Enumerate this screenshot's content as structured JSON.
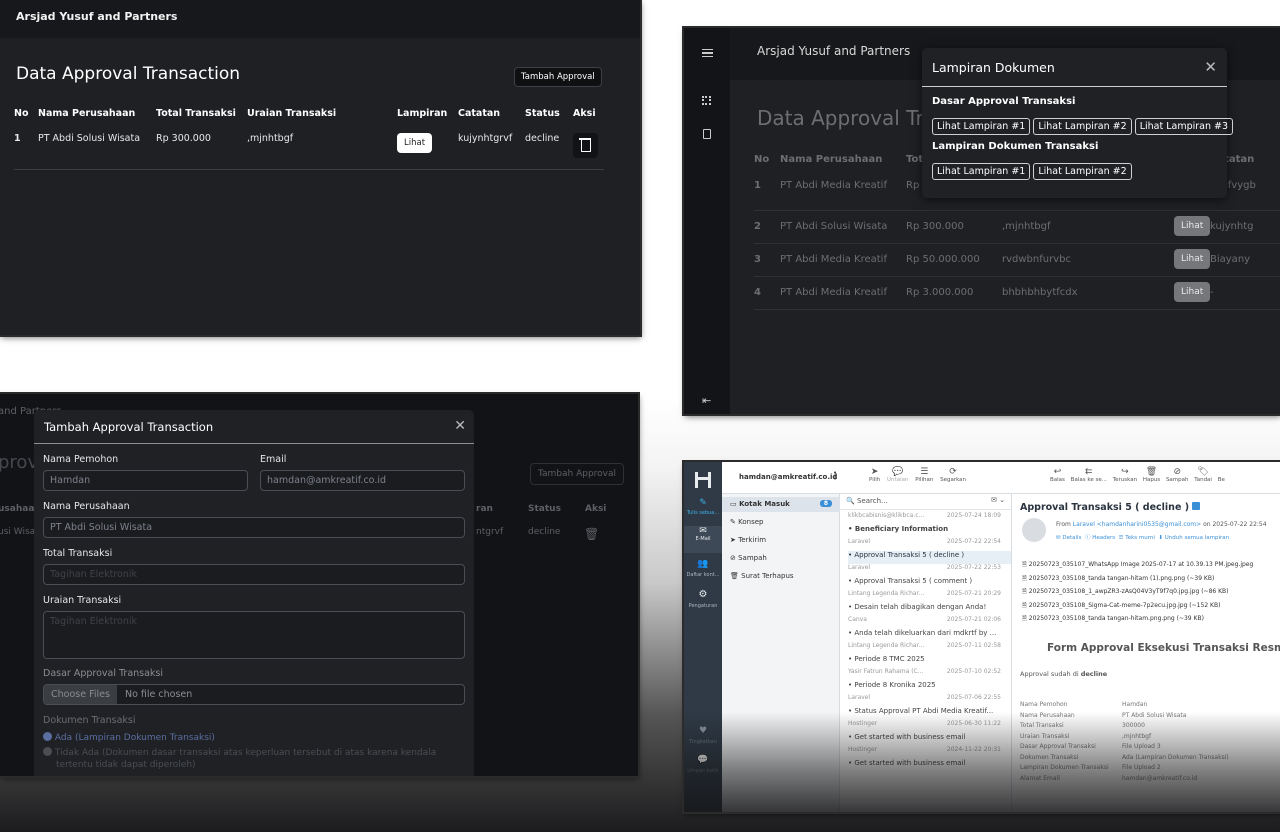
{
  "panel1": {
    "header": "Arsjad Yusuf and Partners",
    "title": "Data Approval Transaction",
    "add_button": "Tambah Approval",
    "columns": [
      "No",
      "Nama Perusahaan",
      "Total Transaksi",
      "Uraian Transaksi",
      "Lampiran",
      "Catatan",
      "Status",
      "Aksi"
    ],
    "rows": [
      {
        "no": "1",
        "company": "PT Abdi Solusi Wisata",
        "total": "Rp 300.000",
        "desc": ",mjnhtbgf",
        "attach": "Lihat",
        "note": "kujynhtgrvf",
        "status": "decline"
      }
    ]
  },
  "panel2": {
    "header": "Arsjad Yusuf and Partners",
    "title_partial": "Data Approval Tr",
    "columns": [
      "No",
      "Nama Perusahaan",
      "Tot",
      "Catatan"
    ],
    "rows": [
      {
        "no": "1",
        "company": "PT Abdi Media Kreatif",
        "total": "Rp",
        "desc": "",
        "attach": "",
        "note": "xdcfvygb"
      },
      {
        "no": "2",
        "company": "PT Abdi Solusi Wisata",
        "total": "Rp 300.000",
        "desc": ",mjnhtbgf",
        "attach": "Lihat",
        "note": "kujynhtg"
      },
      {
        "no": "3",
        "company": "PT Abdi Media Kreatif",
        "total": "Rp 50.000.000",
        "desc": "rvdwbnfurvbc",
        "attach": "Lihat",
        "note": "Biayany"
      },
      {
        "no": "4",
        "company": "PT Abdi Media Kreatif",
        "total": "Rp 3.000.000",
        "desc": "bhbhbhbytfcdx",
        "attach": "Lihat",
        "note": "-"
      }
    ],
    "modal": {
      "title": "Lampiran Dokumen",
      "section1": "Dasar Approval Transaksi",
      "section1_buttons": [
        "Lihat Lampiran #1",
        "Lihat Lampiran #2",
        "Lihat Lampiran #3"
      ],
      "section2": "Lampiran Dokumen Transaksi",
      "section2_buttons": [
        "Lihat Lampiran #1",
        "Lihat Lampiran #2"
      ]
    }
  },
  "panel3": {
    "bg_header": "and Partners",
    "bg_title": "prov",
    "bg_button": "Tambah Approval",
    "bg_cols": [
      "usahaan",
      "ran",
      "Status",
      "Aksi"
    ],
    "bg_row": {
      "company": "usi Wisa",
      "note": "ntgrvf",
      "status": "decline"
    },
    "modal_title": "Tambah Approval Transaction",
    "labels": {
      "requester": "Nama Pemohon",
      "email": "Email",
      "company": "Nama Perusahaan",
      "total": "Total Transaksi",
      "desc": "Uraian Transaksi",
      "basis": "Dasar Approval Transaksi",
      "docs": "Dokumen Transaksi"
    },
    "values": {
      "requester": "Hamdan",
      "email": "hamdan@amkreatif.co.id",
      "company": "PT Abdi Solusi Wisata",
      "total_placeholder": "Tagihan Elektronik",
      "desc_placeholder": "Tagihan Elektronik",
      "file_button": "Choose Files",
      "file_status": "No file chosen"
    },
    "radio1": "Ada (Lampiran Dokumen Transaksi)",
    "radio2_line1": "Tidak Ada (Dokumen dasar transaksi atas keperluan tersebut di atas karena kendala",
    "radio2_line2": "tertentu tidak dapat diperoleh)"
  },
  "panel4": {
    "account": "hamdan@amkreatif.co.id",
    "toolbar1": [
      "Pilih",
      "Untaian",
      "Pilihan",
      "Segarkan"
    ],
    "toolbar2": [
      "Balas",
      "Balas ke se...",
      "Teruskan",
      "Hapus",
      "Sampah",
      "Tandai",
      "Be"
    ],
    "rail": [
      "Tulis sebua...",
      "E-Mail",
      "Daftar kont...",
      "Pengaturan",
      "Tingkatkan",
      "Umpan balik"
    ],
    "folders": [
      {
        "name": "Kotak Masuk",
        "count": "8"
      },
      {
        "name": "Konsep"
      },
      {
        "name": "Terkirim"
      },
      {
        "name": "Sampah"
      },
      {
        "name": "Surat Terhapus"
      }
    ],
    "search_placeholder": "Search...",
    "messages": [
      {
        "from": "klikbcabisnis@klikbca.c...",
        "date": "2025-07-24 18:09",
        "subject": ""
      },
      {
        "from": "",
        "date": "",
        "subject": "Beneficiary Information"
      },
      {
        "from": "Laravel",
        "date": "2025-07-22 22:54",
        "subject": ""
      },
      {
        "from": "",
        "date": "",
        "subject": "Approval Transaksi 5 ( decline )"
      },
      {
        "from": "Laravel",
        "date": "2025-07-22 22:53",
        "subject": ""
      },
      {
        "from": "",
        "date": "",
        "subject": "Approval Transaksi 5 ( comment )"
      },
      {
        "from": "Lintang Legenda Richar...",
        "date": "2025-07-21 20:29",
        "subject": ""
      },
      {
        "from": "",
        "date": "",
        "subject": "Desain telah dibagikan dengan Anda!"
      },
      {
        "from": "Canva",
        "date": "2025-07-21 02:06",
        "subject": ""
      },
      {
        "from": "",
        "date": "",
        "subject": "Anda telah dikeluarkan dari mdkrtf by ..."
      },
      {
        "from": "Lintang Legenda Richar...",
        "date": "2025-07-11 02:58",
        "subject": ""
      },
      {
        "from": "",
        "date": "",
        "subject": "Periode 8 TMC 2025"
      },
      {
        "from": "Yasir Fatrun Rahama (C...",
        "date": "2025-07-10 02:52",
        "subject": ""
      },
      {
        "from": "",
        "date": "",
        "subject": "Periode 8 Kronika 2025"
      },
      {
        "from": "Laravel",
        "date": "2025-07-06 22:55",
        "subject": ""
      },
      {
        "from": "",
        "date": "",
        "subject": "Status Approval PT Abdi Media Kreatif..."
      },
      {
        "from": "Hostinger",
        "date": "2025-06-30 11:22",
        "subject": ""
      },
      {
        "from": "",
        "date": "",
        "subject": "Get started with business email"
      },
      {
        "from": "Hostinger",
        "date": "2024-11-22 20:31",
        "subject": ""
      },
      {
        "from": "",
        "date": "",
        "subject": "Get started with business email"
      }
    ],
    "mail_subject": "Approval Transaksi 5 ( decline )",
    "mail_from_prefix": "From",
    "mail_from": "Laravel <hamdanharini0535@gmail.com>",
    "mail_date": "on 2025-07-22 22:54",
    "mail_links": [
      "Details",
      "Headers",
      "Teks murni",
      "Unduh semua lampiran"
    ],
    "attachments": [
      "20250723_035107_WhatsApp Image 2025-07-17 at 10.39.13 PM.jpeg.jpeg",
      "20250723_035108_tanda tangan-hitam (1).png.png (~39 KB)",
      "20250723_035108_1_awpZR3-zAsQ04V3yT9f7q0.jpg.jpg (~86 KB)",
      "20250723_035108_Sigma-Cat-meme-7p2ecu.jpg.jpg (~152 KB)",
      "20250723_035108_tanda tangan-hitam.png.png (~39 KB)"
    ],
    "form_title": "Form Approval Eksekusi Transaksi Resmi Peru",
    "approval_prefix": "Approval sudah di",
    "approval_status": "decline",
    "details": [
      {
        "k": "Nama Pemohon",
        "v": "Hamdan"
      },
      {
        "k": "Nama Perusahaan",
        "v": "PT Abdi Solusi Wisata"
      },
      {
        "k": "Total Transaksi",
        "v": "300000"
      },
      {
        "k": "Uraian Transaksi",
        "v": ",mjnhtbgf"
      },
      {
        "k": "Dasar Approval Transaksi",
        "v": "File Upload 3"
      },
      {
        "k": "Dokumen Transaksi",
        "v": "Ada (Lampiran Dokumen Transaksi)"
      },
      {
        "k": "Lampiran Dokumen Transaksi",
        "v": "File Upload 2"
      },
      {
        "k": "Alamat Email",
        "v": "hamdan@amkreatif.co.id"
      }
    ]
  }
}
